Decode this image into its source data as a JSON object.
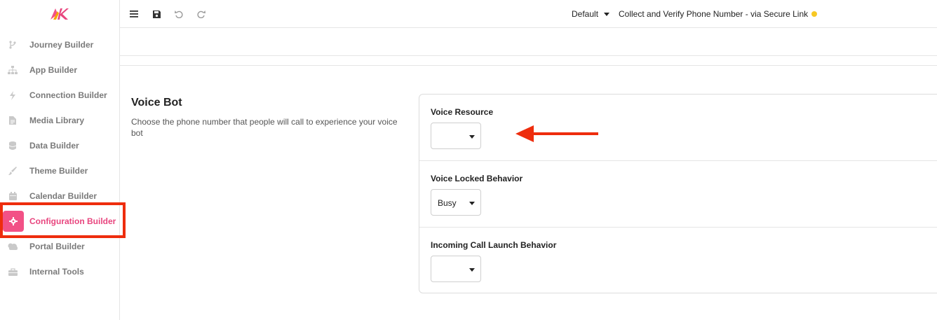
{
  "sidebar": {
    "logo": "logo-icon",
    "items": [
      {
        "label": "Journey Builder",
        "icon": "branch-icon"
      },
      {
        "label": "App Builder",
        "icon": "sitemap-icon"
      },
      {
        "label": "Connection Builder",
        "icon": "bolt-icon"
      },
      {
        "label": "Media Library",
        "icon": "file-icon"
      },
      {
        "label": "Data Builder",
        "icon": "database-icon"
      },
      {
        "label": "Theme Builder",
        "icon": "brush-icon"
      },
      {
        "label": "Calendar Builder",
        "icon": "calendar-icon"
      },
      {
        "label": "Configuration Builder",
        "icon": "gear-icon"
      },
      {
        "label": "Portal Builder",
        "icon": "cloud-icon"
      },
      {
        "label": "Internal Tools",
        "icon": "toolbox-icon"
      }
    ],
    "active_item": "Configuration Builder"
  },
  "toolbar": {
    "icons": [
      "menu-icon",
      "save-icon",
      "undo-icon",
      "redo-icon"
    ],
    "environment": "Default",
    "project_name": "Collect and Verify Phone Number - via Secure Link",
    "status_color": "#f7c824"
  },
  "section": {
    "title": "Voice Bot",
    "description": "Choose the phone number that people will call to experience your voice bot"
  },
  "fields": {
    "voice_resource": {
      "label": "Voice Resource",
      "value": ""
    },
    "voice_locked_behavior": {
      "label": "Voice Locked Behavior",
      "value": "Busy"
    },
    "incoming_call_launch_behavior": {
      "label": "Incoming Call Launch Behavior",
      "value": ""
    }
  },
  "colors": {
    "accent": "#f25186",
    "active_text": "#e8457e",
    "annotation": "#ee2d0d"
  }
}
